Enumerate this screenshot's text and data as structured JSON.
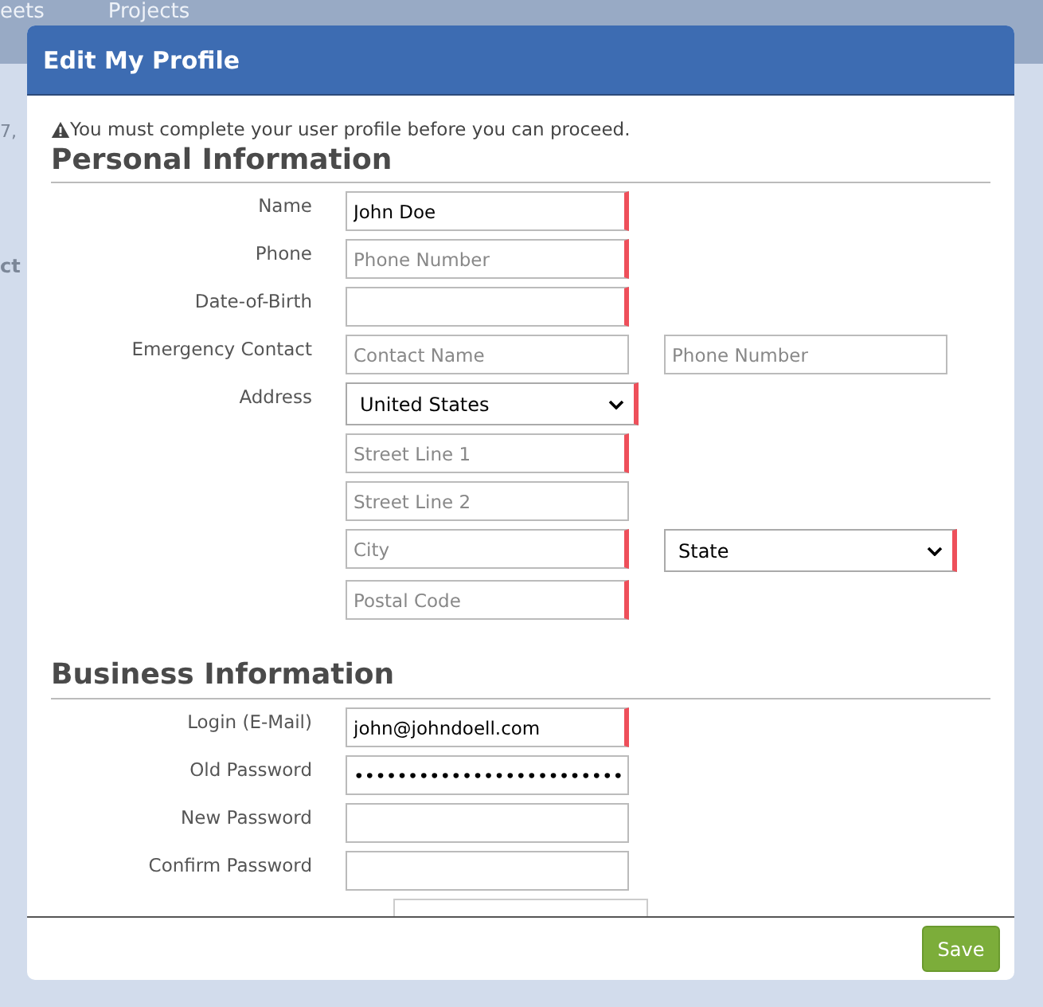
{
  "background": {
    "nav": [
      "eets",
      "Projects"
    ],
    "field_text": "7,",
    "heading_text": "ct"
  },
  "dialog": {
    "title": "Edit My Profile",
    "notice": "You must complete your user profile before you can proceed.",
    "sections": [
      {
        "heading": "Personal Information",
        "rows": [
          {
            "label": "Name",
            "fields": [
              {
                "kind": "input",
                "value": "John Doe",
                "required": true
              }
            ]
          },
          {
            "label": "Phone",
            "fields": [
              {
                "kind": "input",
                "placeholder": "Phone Number",
                "required": true
              }
            ]
          },
          {
            "label": "Date-of-Birth",
            "fields": [
              {
                "kind": "input",
                "required": true
              }
            ]
          },
          {
            "label": "Emergency Contact",
            "fields": [
              {
                "kind": "input",
                "placeholder": "Contact Name",
                "required": false
              },
              {
                "kind": "input",
                "placeholder": "Phone Number",
                "required": false
              }
            ]
          },
          {
            "label": "Address",
            "fields": [
              {
                "kind": "select",
                "value": "United States",
                "required": true
              }
            ]
          },
          {
            "fields": [
              {
                "kind": "input",
                "placeholder": "Street Line 1",
                "required": true
              }
            ]
          },
          {
            "fields": [
              {
                "kind": "input",
                "placeholder": "Street Line 2",
                "required": false
              }
            ]
          },
          {
            "fields": [
              {
                "kind": "input",
                "placeholder": "City",
                "required": true
              },
              {
                "kind": "select",
                "value": "State",
                "required": true
              }
            ]
          },
          {
            "fields": [
              {
                "kind": "input",
                "placeholder": "Postal Code",
                "required": true
              }
            ]
          }
        ]
      },
      {
        "heading": "Business Information",
        "rows": [
          {
            "label": "Login (E-Mail)",
            "fields": [
              {
                "kind": "input",
                "value": "john@johndoell.com",
                "required": true
              }
            ]
          },
          {
            "label": "Old Password",
            "fields": [
              {
                "kind": "input",
                "value": "•••••••••••••••••••••••••",
                "required": false
              }
            ]
          },
          {
            "label": "New Password",
            "fields": [
              {
                "kind": "input",
                "required": false
              }
            ]
          },
          {
            "label": "Confirm Password",
            "fields": [
              {
                "kind": "input",
                "required": false
              }
            ]
          },
          {
            "fields": [
              {
                "kind": "cutoff"
              }
            ]
          }
        ]
      }
    ],
    "buttons": [
      {
        "label": "Save"
      }
    ]
  }
}
